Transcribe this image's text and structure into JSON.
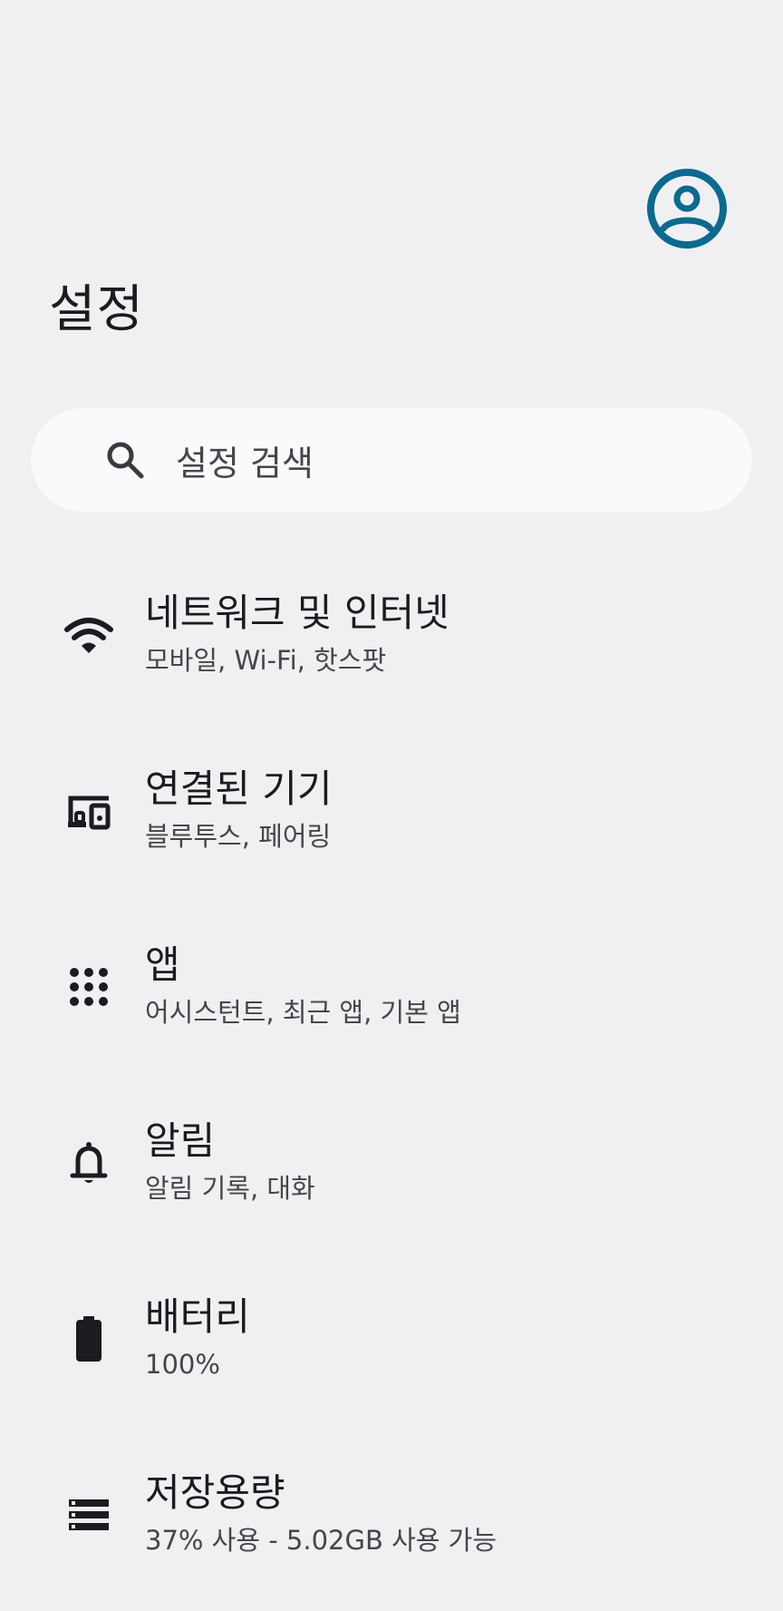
{
  "header": {
    "title": "설정",
    "account_icon": "account-circle-icon",
    "accent_color": "#0b6a8f"
  },
  "search": {
    "placeholder": "설정 검색",
    "icon": "search-icon"
  },
  "items": [
    {
      "icon": "wifi-icon",
      "title": "네트워크 및 인터넷",
      "summary": "모바일, Wi-Fi, 핫스팟"
    },
    {
      "icon": "connected-devices-icon",
      "title": "연결된 기기",
      "summary": "블루투스, 페어링"
    },
    {
      "icon": "apps-grid-icon",
      "title": "앱",
      "summary": "어시스턴트, 최근 앱, 기본 앱"
    },
    {
      "icon": "bell-icon",
      "title": "알림",
      "summary": "알림 기록, 대화"
    },
    {
      "icon": "battery-icon",
      "title": "배터리",
      "summary": "100%"
    },
    {
      "icon": "storage-icon",
      "title": "저장용량",
      "summary": "37% 사용 - 5.02GB 사용 가능"
    }
  ]
}
